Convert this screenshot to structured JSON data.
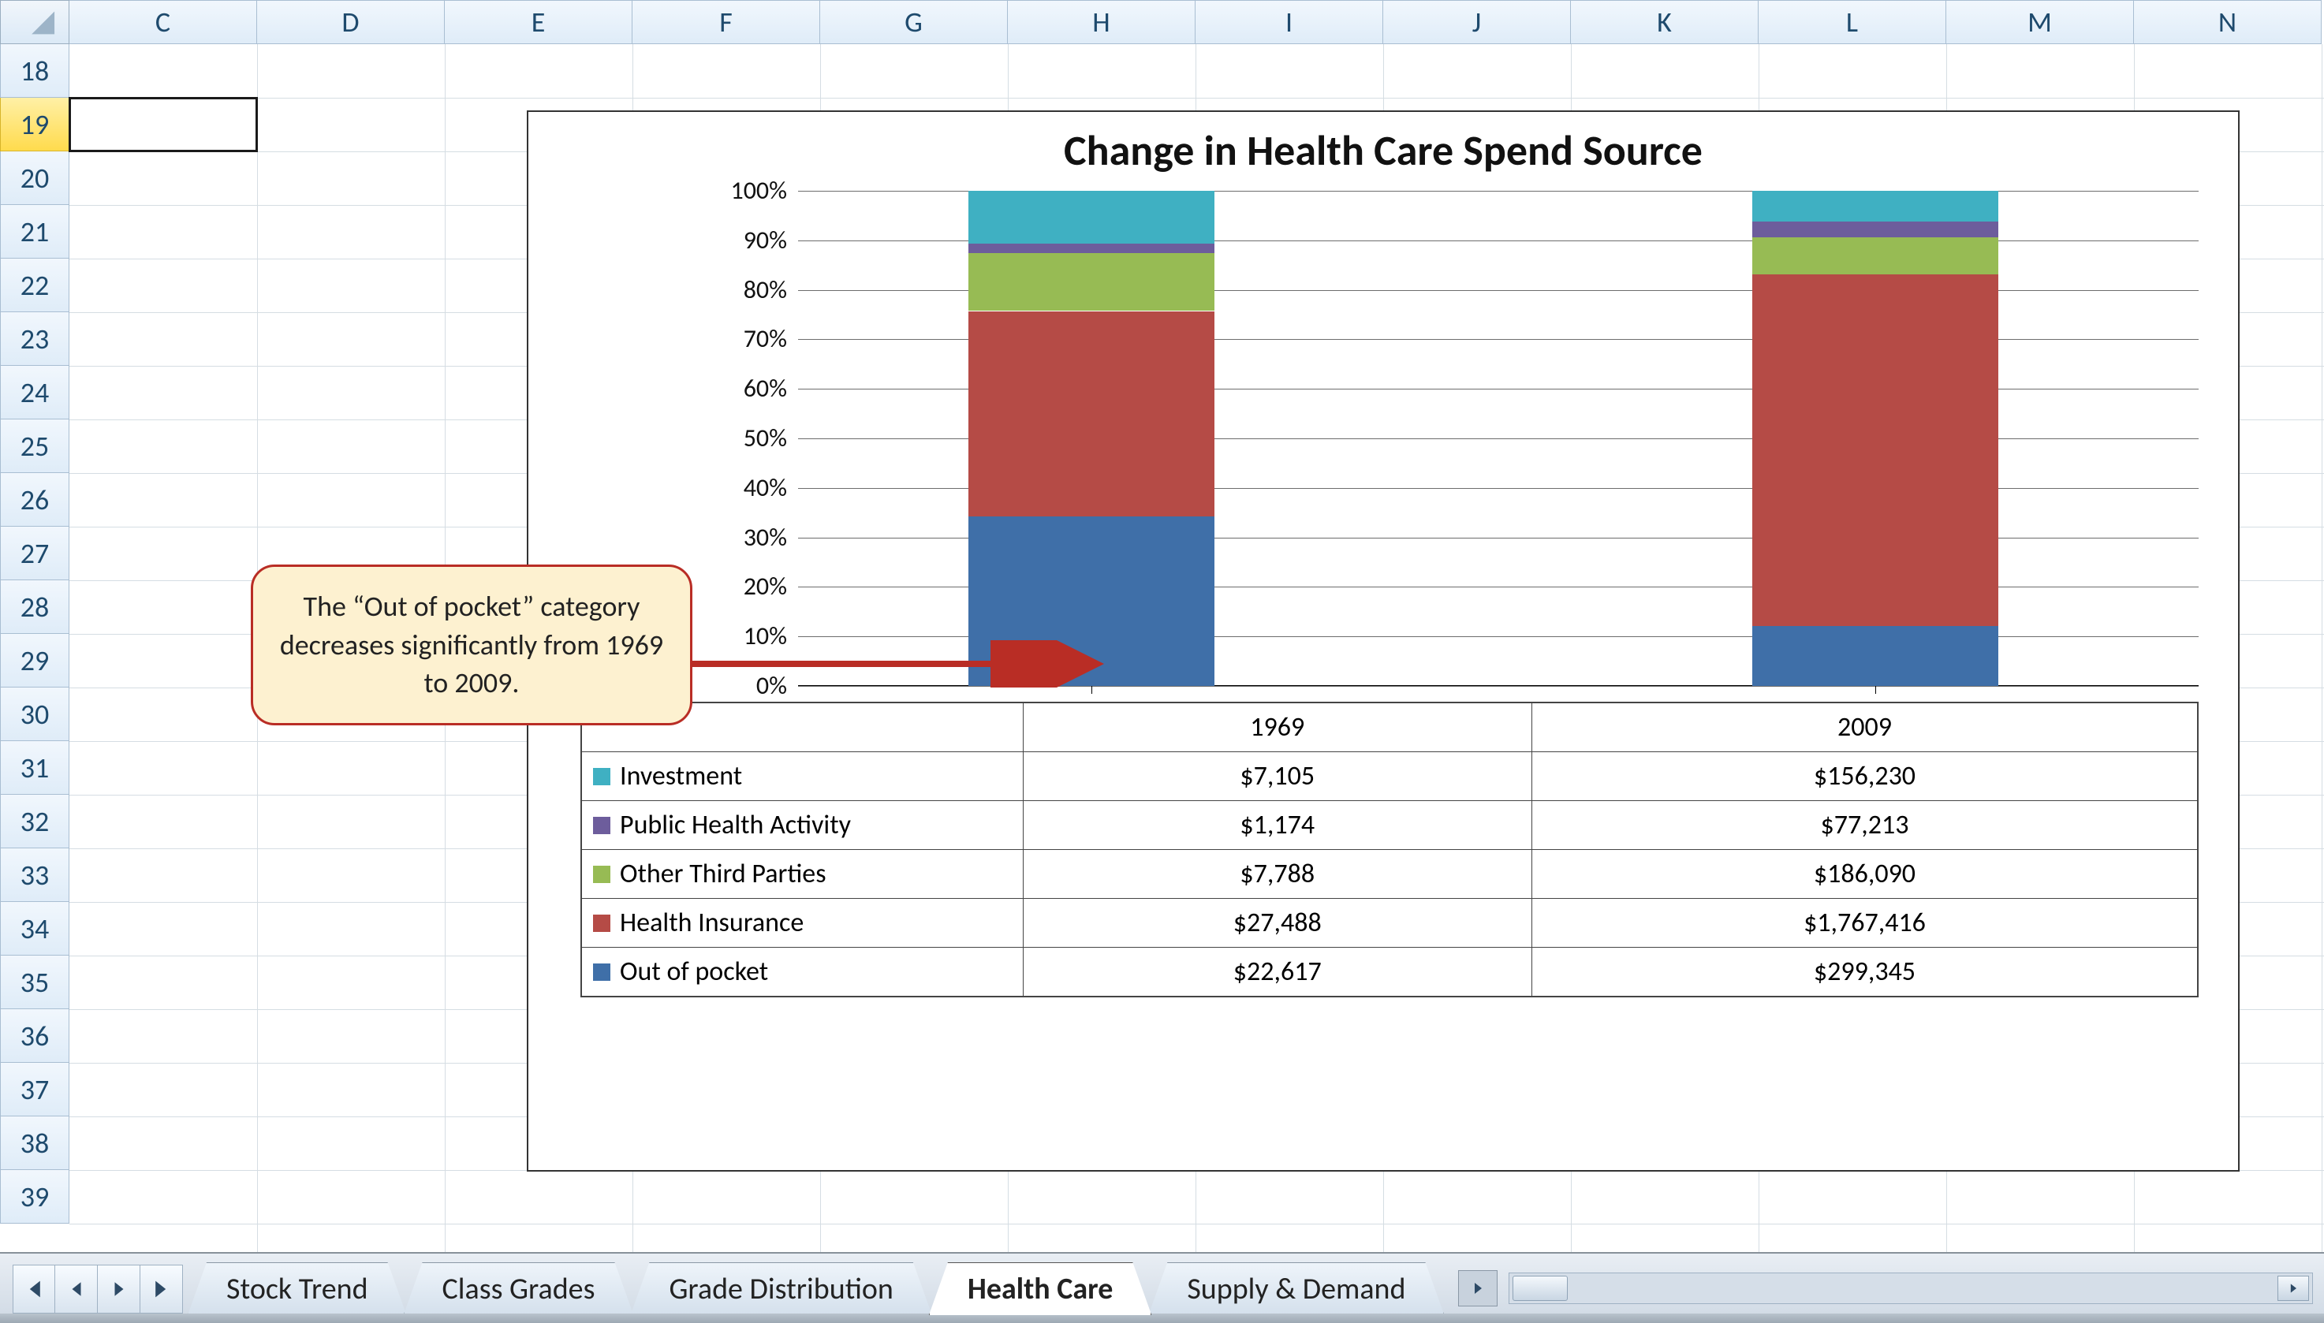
{
  "columns": [
    "C",
    "D",
    "E",
    "F",
    "G",
    "H",
    "I",
    "J",
    "K",
    "L",
    "M",
    "N"
  ],
  "rows": [
    "18",
    "19",
    "20",
    "21",
    "22",
    "23",
    "24",
    "25",
    "26",
    "27",
    "28",
    "29",
    "30",
    "31",
    "32",
    "33",
    "34",
    "35",
    "36",
    "37",
    "38",
    "39"
  ],
  "selected_row": "19",
  "chart_title": "Change in Health Care Spend Source",
  "y_ticks": [
    "0%",
    "10%",
    "20%",
    "30%",
    "40%",
    "50%",
    "60%",
    "70%",
    "80%",
    "90%",
    "100%"
  ],
  "callout_text": "The “Out of pocket” category decreases significantly from 1969 to 2009.",
  "table_cols": [
    "1969",
    "2009"
  ],
  "legend_rows": [
    {
      "label": "Investment",
      "color": "c-teal",
      "v1": "$7,105",
      "v2": "$156,230"
    },
    {
      "label": "Public Health Activity",
      "color": "c-purple",
      "v1": "$1,174",
      "v2": "$77,213"
    },
    {
      "label": "Other Third Parties",
      "color": "c-green",
      "v1": "$7,788",
      "v2": "$186,090"
    },
    {
      "label": "Health Insurance",
      "color": "c-red",
      "v1": "$27,488",
      "v2": "$1,767,416"
    },
    {
      "label": "Out of pocket",
      "color": "c-blue",
      "v1": "$22,617",
      "v2": "$299,345"
    }
  ],
  "tabs": [
    {
      "label": "Stock Trend",
      "active": false
    },
    {
      "label": "Class Grades",
      "active": false
    },
    {
      "label": "Grade Distribution",
      "active": false
    },
    {
      "label": "Health Care",
      "active": true
    },
    {
      "label": "Supply & Demand",
      "active": false
    }
  ],
  "chart_data": {
    "type": "bar",
    "stacked": true,
    "percent": true,
    "title": "Change in Health Care Spend Source",
    "ylabel": "",
    "ylim": [
      0,
      100
    ],
    "categories": [
      "1969",
      "2009"
    ],
    "series": [
      {
        "name": "Out of pocket",
        "color": "#3f6fa8",
        "values": [
          22617,
          299345
        ]
      },
      {
        "name": "Health Insurance",
        "color": "#b54b46",
        "values": [
          27488,
          1767416
        ]
      },
      {
        "name": "Other Third Parties",
        "color": "#97bb54",
        "values": [
          7788,
          186090
        ]
      },
      {
        "name": "Public Health Activity",
        "color": "#6d5d9c",
        "values": [
          1174,
          77213
        ]
      },
      {
        "name": "Investment",
        "color": "#3fb0c2",
        "values": [
          7105,
          156230
        ]
      }
    ],
    "annotation": "The “Out of pocket” category decreases significantly from 1969 to 2009."
  }
}
